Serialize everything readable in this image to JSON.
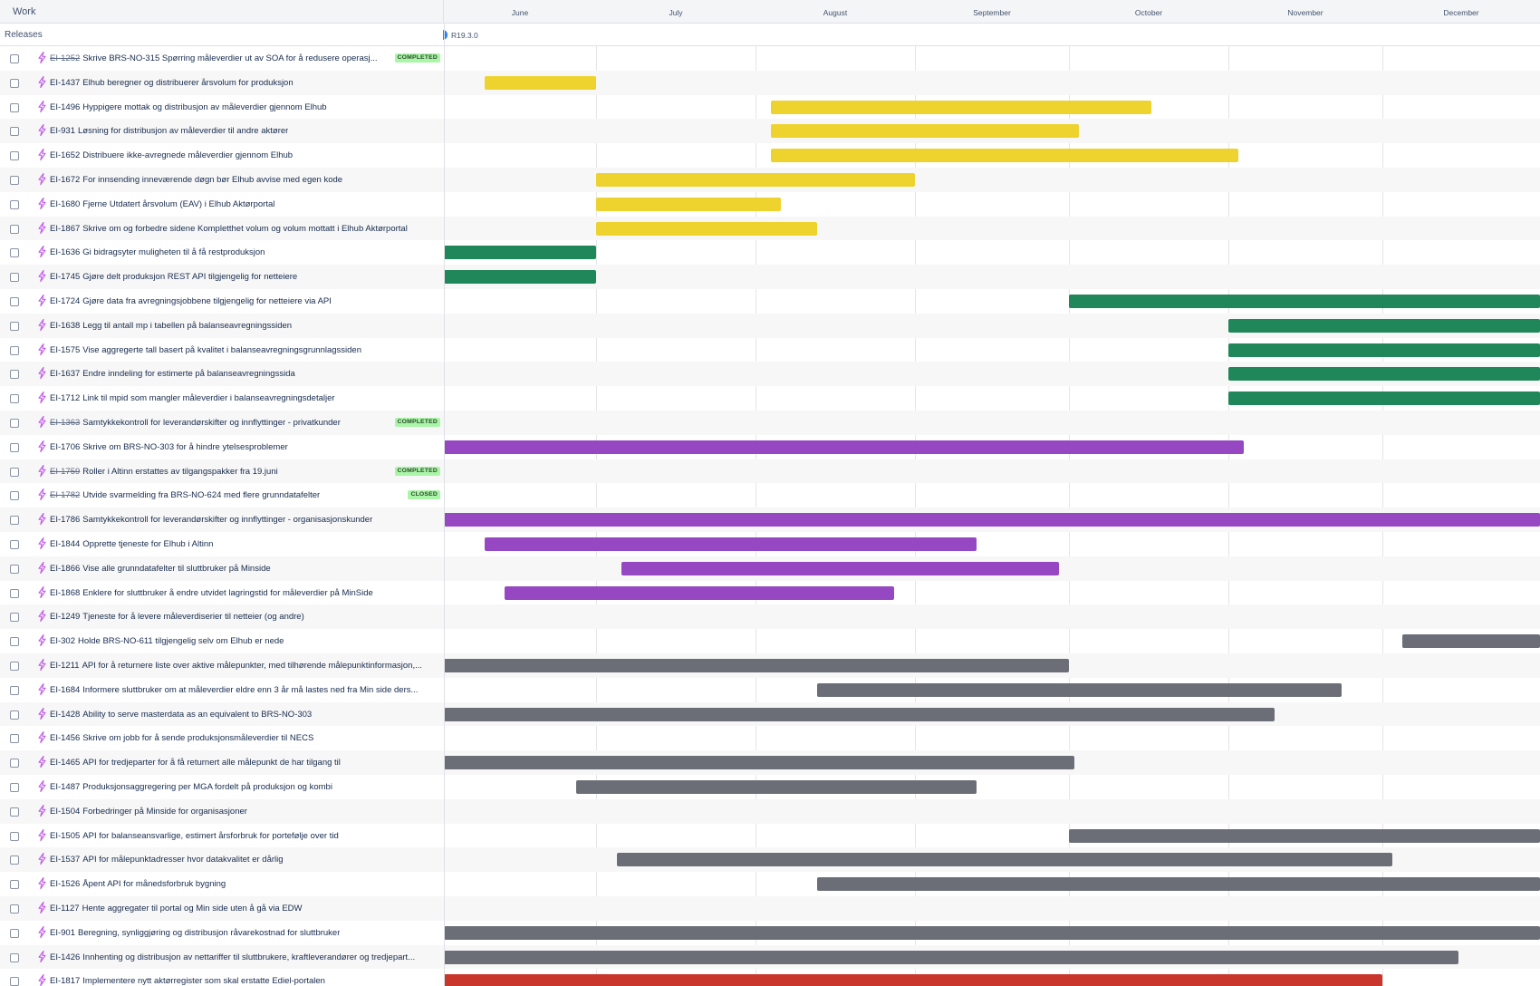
{
  "header": {
    "work_label": "Work",
    "months": [
      "June",
      "July",
      "August",
      "September",
      "October",
      "November",
      "December"
    ]
  },
  "releases": {
    "label": "Releases",
    "release_name": "R19.3.0"
  },
  "colors": {
    "yellow": "#eed22e",
    "green": "#1f8759",
    "purple": "#9548c2",
    "gray": "#6b6e76",
    "red": "#c9372c",
    "icon": "#c159e8",
    "release_marker": "#2684ff",
    "badge_bg": "#abf5a8"
  },
  "rows": [
    {
      "key": "EI-1252",
      "title": "Skrive BRS-NO-315 Spørring måleverdier ut av SOA for å redusere operasj...",
      "done": true,
      "status": "COMPLETED"
    },
    {
      "key": "EI-1437",
      "title": "Elhub beregner og distribuerer årsvolum for produksjon",
      "bar": {
        "color": "yellow",
        "start": "2024-06-09",
        "end": "2024-07-01"
      }
    },
    {
      "key": "EI-1496",
      "title": "Hyppigere mottak og distribusjon av måleverdier gjennom Elhub",
      "bar": {
        "color": "yellow",
        "start": "2024-08-04",
        "end": "2024-10-17"
      }
    },
    {
      "key": "EI-931",
      "title": "Løsning for distribusjon av måleverdier til andre aktører",
      "bar": {
        "color": "yellow",
        "start": "2024-08-04",
        "end": "2024-10-03"
      }
    },
    {
      "key": "EI-1652",
      "title": "Distribuere ikke-avregnede måleverdier gjennom Elhub",
      "bar": {
        "color": "yellow",
        "start": "2024-08-04",
        "end": "2024-11-03"
      }
    },
    {
      "key": "EI-1672",
      "title": "For innsending inneværende døgn bør Elhub avvise med egen kode",
      "bar": {
        "color": "yellow",
        "start": "2024-07-01",
        "end": "2024-09-01"
      }
    },
    {
      "key": "EI-1680",
      "title": "Fjerne Utdatert årsvolum (EAV) i Elhub Aktørportal",
      "bar": {
        "color": "yellow",
        "start": "2024-07-01",
        "end": "2024-08-06"
      }
    },
    {
      "key": "EI-1867",
      "title": "Skrive om og forbedre sidene Kompletthet volum og volum mottatt i Elhub Aktørportal",
      "bar": {
        "color": "yellow",
        "start": "2024-07-01",
        "end": "2024-08-13"
      }
    },
    {
      "key": "EI-1636",
      "title": "Gi bidragsyter muligheten til å få restproduksjon",
      "bar": {
        "color": "green",
        "start": "2024-06-01",
        "end": "2024-07-01"
      }
    },
    {
      "key": "EI-1745",
      "title": "Gjøre delt produksjon REST API tilgjengelig for netteiere",
      "bar": {
        "color": "green",
        "start": "2024-06-01",
        "end": "2024-07-01"
      }
    },
    {
      "key": "EI-1724",
      "title": "Gjøre data fra avregningsjobbene tilgjengelig for netteiere via API",
      "bar": {
        "color": "green",
        "start": "2024-10-01",
        "end": "2025-01-01"
      }
    },
    {
      "key": "EI-1638",
      "title": "Legg til antall mp i tabellen på balanseavregningssiden",
      "bar": {
        "color": "green",
        "start": "2024-11-01",
        "end": "2025-01-01"
      }
    },
    {
      "key": "EI-1575",
      "title": "Vise aggregerte tall basert på kvalitet i balanseavregningsgrunnlagssiden",
      "bar": {
        "color": "green",
        "start": "2024-11-01",
        "end": "2025-01-01"
      }
    },
    {
      "key": "EI-1637",
      "title": "Endre inndeling for estimerte på balanseavregningssida",
      "bar": {
        "color": "green",
        "start": "2024-11-01",
        "end": "2025-01-01"
      }
    },
    {
      "key": "EI-1712",
      "title": "Link til mpid som mangler måleverdier i balanseavregningsdetaljer",
      "bar": {
        "color": "green",
        "start": "2024-11-01",
        "end": "2025-01-01"
      }
    },
    {
      "key": "EI-1363",
      "title": "Samtykkekontroll for leverandørskifter og innflyttinger - privatkunder",
      "done": true,
      "status": "COMPLETED"
    },
    {
      "key": "EI-1706",
      "title": "Skrive om BRS-NO-303 for å hindre ytelsesproblemer",
      "bar": {
        "color": "purple",
        "start": "2024-06-01",
        "end": "2024-11-04"
      }
    },
    {
      "key": "EI-1759",
      "title": "Roller i Altinn erstattes av tilgangspakker fra 19.juni",
      "done": true,
      "status": "COMPLETED"
    },
    {
      "key": "EI-1782",
      "title": "Utvide svarmelding fra BRS-NO-624 med flere grunndatafelter",
      "done": true,
      "status": "CLOSED"
    },
    {
      "key": "EI-1786",
      "title": "Samtykkekontroll for leverandørskifter og innflyttinger - organisasjonskunder",
      "bar": {
        "color": "purple",
        "start": "2024-06-01",
        "end": "2025-01-01"
      }
    },
    {
      "key": "EI-1844",
      "title": "Opprette tjeneste for Elhub i Altinn",
      "bar": {
        "color": "purple",
        "start": "2024-06-09",
        "end": "2024-09-13"
      }
    },
    {
      "key": "EI-1866",
      "title": "Vise alle grunndatafelter til sluttbruker på Minside",
      "bar": {
        "color": "purple",
        "start": "2024-07-06",
        "end": "2024-09-29"
      }
    },
    {
      "key": "EI-1868",
      "title": "Enklere for sluttbruker å endre utvidet lagringstid for måleverdier på MinSide",
      "bar": {
        "color": "purple",
        "start": "2024-06-13",
        "end": "2024-08-28"
      }
    },
    {
      "key": "EI-1249",
      "title": "Tjeneste for å levere måleverdiserier til netteier (og andre)"
    },
    {
      "key": "EI-302",
      "title": "Holde BRS-NO-611 tilgjengelig selv om Elhub er nede",
      "bar": {
        "color": "gray",
        "start": "2024-12-05",
        "end": "2025-01-01"
      }
    },
    {
      "key": "EI-1211",
      "title": "API for å returnere liste over aktive målepunkter, med tilhørende målepunktinformasjon,...",
      "bar": {
        "color": "gray",
        "start": "2024-06-01",
        "end": "2024-10-01"
      }
    },
    {
      "key": "EI-1684",
      "title": "Informere sluttbruker om at måleverdier eldre enn 3 år må lastes ned fra Min side ders...",
      "bar": {
        "color": "gray",
        "start": "2024-08-13",
        "end": "2024-11-23"
      }
    },
    {
      "key": "EI-1428",
      "title": "Ability to serve masterdata as an equivalent to BRS-NO-303",
      "bar": {
        "color": "gray",
        "start": "2024-06-01",
        "end": "2024-11-10"
      }
    },
    {
      "key": "EI-1456",
      "title": "Skrive om jobb for å sende produksjonsmåleverdier til NECS"
    },
    {
      "key": "EI-1465",
      "title": "API for tredjeparter for å få returnert alle målepunkt de har tilgang til",
      "bar": {
        "color": "gray",
        "start": "2024-06-01",
        "end": "2024-10-02"
      }
    },
    {
      "key": "EI-1487",
      "title": "Produksjonsaggregering per MGA fordelt på produksjon og kombi",
      "bar": {
        "color": "gray",
        "start": "2024-06-27",
        "end": "2024-09-13"
      }
    },
    {
      "key": "EI-1504",
      "title": "Forbedringer på Minside for organisasjoner"
    },
    {
      "key": "EI-1505",
      "title": "API for balanseansvarlige, estimert årsforbruk for portefølje over tid",
      "bar": {
        "color": "gray",
        "start": "2024-10-01",
        "end": "2025-01-01"
      }
    },
    {
      "key": "EI-1537",
      "title": "API for målepunktadresser hvor datakvalitet er dårlig",
      "bar": {
        "color": "gray",
        "start": "2024-07-05",
        "end": "2024-12-03"
      }
    },
    {
      "key": "EI-1526",
      "title": "Åpent API for månedsforbruk bygning",
      "bar": {
        "color": "gray",
        "start": "2024-08-13",
        "end": "2025-01-01"
      }
    },
    {
      "key": "EI-1127",
      "title": "Hente aggregater til portal og Min side uten å gå via EDW"
    },
    {
      "key": "EI-901",
      "title": "Beregning, synliggjøring og distribusjon råvarekostnad for sluttbruker",
      "bar": {
        "color": "gray",
        "start": "2024-06-01",
        "end": "2025-01-01"
      }
    },
    {
      "key": "EI-1426",
      "title": "Innhenting og distribusjon av nettariffer til sluttbrukere, kraftleverandører og tredjepart...",
      "bar": {
        "color": "gray",
        "start": "2024-06-01",
        "end": "2024-12-16"
      }
    },
    {
      "key": "EI-1817",
      "title": "Implementere nytt aktørregister som skal erstatte Ediel-portalen",
      "bar": {
        "color": "red",
        "start": "2024-06-01",
        "end": "2024-12-01"
      }
    }
  ]
}
